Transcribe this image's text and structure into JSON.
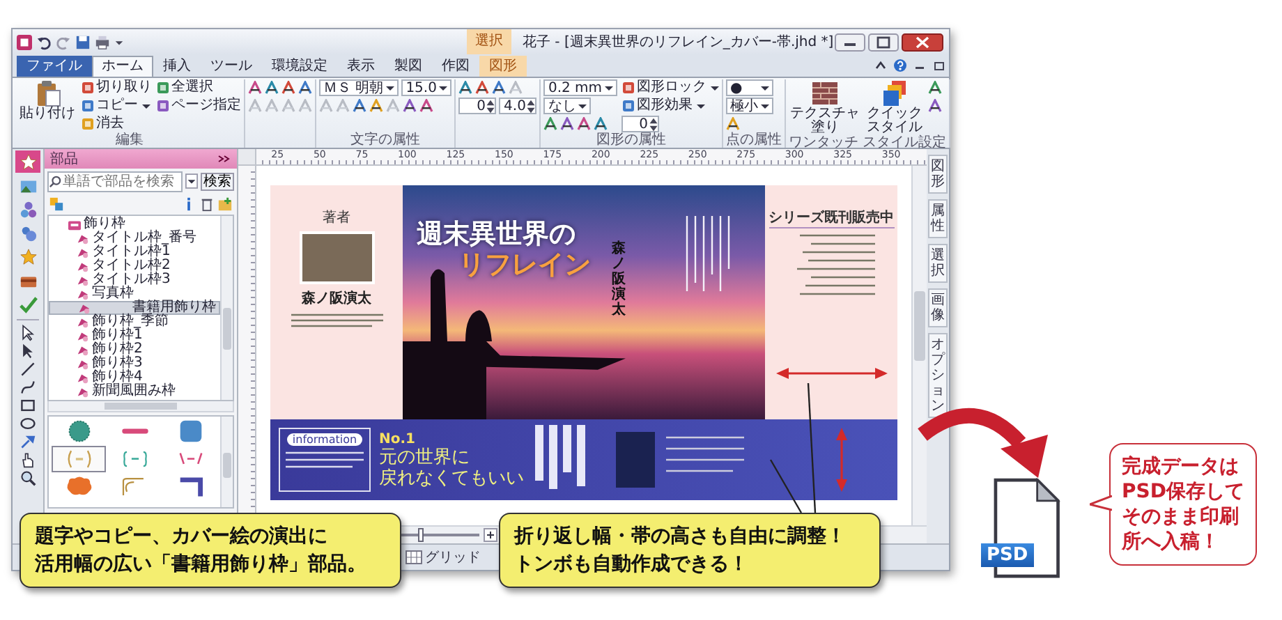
{
  "window": {
    "title": "花子 - [週末異世界のリフレイン_カバー-帯.jhd *]",
    "context_group": "選択"
  },
  "tabs": [
    {
      "label": "ファイル",
      "kind": "file",
      "selected": false
    },
    {
      "label": "ホーム",
      "kind": "normal",
      "selected": true
    },
    {
      "label": "挿入",
      "kind": "normal",
      "selected": false
    },
    {
      "label": "ツール",
      "kind": "normal",
      "selected": false
    },
    {
      "label": "環境設定",
      "kind": "normal",
      "selected": false
    },
    {
      "label": "表示",
      "kind": "normal",
      "selected": false
    },
    {
      "label": "製図",
      "kind": "normal",
      "selected": false
    },
    {
      "label": "作図",
      "kind": "normal",
      "selected": false
    },
    {
      "label": "図形",
      "kind": "context",
      "selected": false
    }
  ],
  "ribbon": [
    {
      "label": "編集",
      "columns": [
        [
          [
            {
              "kind": "big",
              "label": [
                "貼り付け"
              ]
            }
          ]
        ],
        [
          [
            {
              "kind": "small",
              "label": "切り取り",
              "menu": false
            }
          ],
          [
            {
              "kind": "small",
              "label": "コピー",
              "menu": true
            }
          ],
          [
            {
              "kind": "small",
              "label": "消去",
              "menu": false
            }
          ]
        ],
        [
          [
            {
              "kind": "small",
              "label": "全選択",
              "menu": false
            }
          ],
          [
            {
              "kind": "small",
              "label": "ページ指定",
              "menu": false
            }
          ]
        ]
      ]
    },
    {
      "columns": [
        [
          [
            {
              "kind": "icon",
              "disabled": false
            },
            {
              "kind": "icon",
              "disabled": false
            },
            {
              "kind": "icon",
              "disabled": false
            },
            {
              "kind": "icon",
              "disabled": false
            }
          ],
          [
            {
              "kind": "icon",
              "disabled": true
            },
            {
              "kind": "icon",
              "disabled": true
            },
            {
              "kind": "icon",
              "disabled": true
            },
            {
              "kind": "icon",
              "disabled": true
            }
          ]
        ]
      ]
    },
    {
      "label": "文字の属性",
      "columns": [
        [
          [
            {
              "kind": "select",
              "value": "ＭＳ 明朝"
            },
            {
              "kind": "select",
              "value": "15.0"
            }
          ],
          [
            {
              "kind": "icon",
              "disabled": true
            },
            {
              "kind": "icon",
              "disabled": true
            },
            {
              "kind": "icon",
              "disabled": false
            },
            {
              "kind": "icon",
              "disabled": false
            },
            {
              "kind": "icon",
              "disabled": true
            },
            {
              "kind": "icon",
              "disabled": false
            },
            {
              "kind": "icon",
              "disabled": false
            }
          ]
        ]
      ]
    },
    {
      "columns": [
        [
          [
            {
              "kind": "icon",
              "disabled": false
            },
            {
              "kind": "icon",
              "disabled": false
            },
            {
              "kind": "icon",
              "disabled": false
            },
            {
              "kind": "icon",
              "disabled": true
            }
          ],
          [
            {
              "kind": "spin",
              "value": "0"
            },
            {
              "kind": "spin",
              "value": "4.0"
            }
          ]
        ]
      ]
    },
    {
      "label": "図形の属性",
      "columns": [
        [
          [
            {
              "kind": "select",
              "value": "0.2 mm"
            }
          ],
          [
            {
              "kind": "select",
              "value": "なし"
            }
          ],
          [
            {
              "kind": "icon",
              "disabled": false
            },
            {
              "kind": "icon",
              "disabled": false
            },
            {
              "kind": "icon",
              "disabled": false
            },
            {
              "kind": "icon",
              "disabled": false
            }
          ]
        ],
        [
          [
            {
              "kind": "small",
              "label": "図形ロック",
              "menu": true
            }
          ],
          [
            {
              "kind": "small",
              "label": "図形効果",
              "menu": true
            }
          ],
          [
            {
              "kind": "spin",
              "value": "0"
            }
          ]
        ]
      ]
    },
    {
      "label": "点の属性",
      "columns": [
        [
          [
            {
              "kind": "select",
              "value": "●"
            }
          ],
          [
            {
              "kind": "select",
              "value": "極小"
            }
          ],
          [
            {
              "kind": "icon",
              "disabled": false
            }
          ]
        ]
      ]
    },
    {
      "label": "ワンタッチ スタイル設定",
      "columns": [
        [
          [
            {
              "kind": "big",
              "label": [
                "テクスチャ",
                "塗り"
              ]
            }
          ]
        ],
        [
          [
            {
              "kind": "big",
              "label": [
                "クイック",
                "スタイル"
              ]
            }
          ]
        ],
        [
          [
            {
              "kind": "icon",
              "disabled": false
            }
          ],
          [
            {
              "kind": "icon",
              "disabled": false
            }
          ]
        ]
      ]
    }
  ],
  "panel_tabs": [
    {
      "selected": true
    },
    {
      "selected": false
    },
    {
      "selected": false
    },
    {
      "selected": false
    },
    {
      "selected": false
    },
    {
      "selected": false
    },
    {
      "selected": false
    }
  ],
  "parts_panel": {
    "title": "部品",
    "search": {
      "placeholder": "単語で部品を検索"
    },
    "search_button": "検索",
    "tree": [
      {
        "label": "飾り枠",
        "expanded": true,
        "selected": false,
        "children": [
          {
            "label": "タイトル枠_番号",
            "selected": false
          },
          {
            "label": "タイトル枠1",
            "selected": false
          },
          {
            "label": "タイトル枠2",
            "selected": false
          },
          {
            "label": "タイトル枠3",
            "selected": false
          },
          {
            "label": "写真枠",
            "selected": false
          },
          {
            "label": "書籍用飾り枠",
            "selected": true
          },
          {
            "label": "飾り枠_季節",
            "selected": false
          },
          {
            "label": "飾り枠1",
            "selected": false
          },
          {
            "label": "飾り枠2",
            "selected": false
          },
          {
            "label": "飾り枠3",
            "selected": false
          },
          {
            "label": "飾り枠4",
            "selected": false
          },
          {
            "label": "新聞風囲み枠",
            "selected": false
          }
        ]
      }
    ],
    "thumbnails": [
      {
        "kind": "scallop",
        "selected": false
      },
      {
        "kind": "bar",
        "selected": false
      },
      {
        "kind": "rounded",
        "selected": false
      },
      {
        "kind": "brackets",
        "selected": true
      },
      {
        "kind": "braces",
        "selected": false
      },
      {
        "kind": "slashes",
        "selected": false
      },
      {
        "kind": "cloud",
        "selected": false
      },
      {
        "kind": "corner",
        "selected": false
      },
      {
        "kind": "lframe",
        "selected": false
      }
    ]
  },
  "canvas": {
    "ruler_labels": [
      "25",
      "50",
      "75",
      "100",
      "125",
      "150",
      "175",
      "200",
      "225",
      "250",
      "275",
      "300",
      "325",
      "350"
    ],
    "document": {
      "left_flap": {
        "heading": "著者",
        "author": "森ノ阪演太"
      },
      "cover": {
        "title_lines": [
          "週末異世界の",
          "リフレイン"
        ],
        "author": "森ノ阪演太"
      },
      "right_flap": {
        "heading": "シリーズ既刊販売中"
      },
      "band": {
        "info_label": "information",
        "rank": "No.1",
        "catch_lines": [
          "元の世界に",
          "戻れなくてもいい"
        ]
      }
    }
  },
  "side_tabs": [
    {
      "label": "図形"
    },
    {
      "label": "属性"
    },
    {
      "label": "選択"
    },
    {
      "label": "画像"
    },
    {
      "label": "オプション"
    }
  ],
  "status_bar": {
    "zoom": {
      "level": 0.3
    },
    "grid": "グリッド"
  },
  "callouts": [
    {
      "lines": [
        "題字やコピー、カバー絵の演出に",
        "活用幅の広い「書籍用飾り枠」部品。"
      ]
    },
    {
      "lines": [
        "折り返し幅・帯の高さも自由に調整！",
        "トンボも自動作成できる！"
      ]
    }
  ],
  "export": {
    "file_badge": "PSD",
    "bubble": [
      "完成データは",
      "PSD保存して",
      "そのまま印刷",
      "所へ入稿！"
    ]
  }
}
